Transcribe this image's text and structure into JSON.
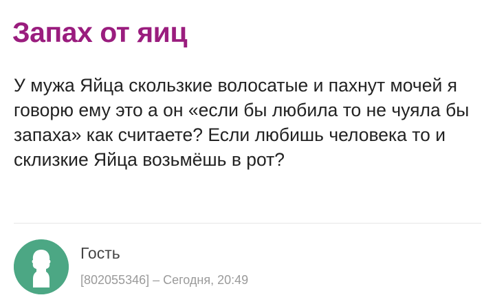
{
  "post": {
    "title": "Запах от яиц",
    "body": "У мужа Яйца скользкие волосатые и пахнут мочей я говорю ему это а он «если бы любила то не чуяла бы запаха» как считаете? Если любишь человека то и склизкие Яйца возьмёшь в рот?"
  },
  "author": {
    "name": "Гость",
    "user_id": "[802055346]",
    "separator": " – ",
    "time": "Сегодня, 20:49"
  },
  "colors": {
    "title": "#9a1d7e",
    "avatar_bg": "#4ca784",
    "text": "#222222",
    "meta": "#9a9a9a"
  },
  "icons": {
    "avatar": "person-silhouette-icon"
  }
}
